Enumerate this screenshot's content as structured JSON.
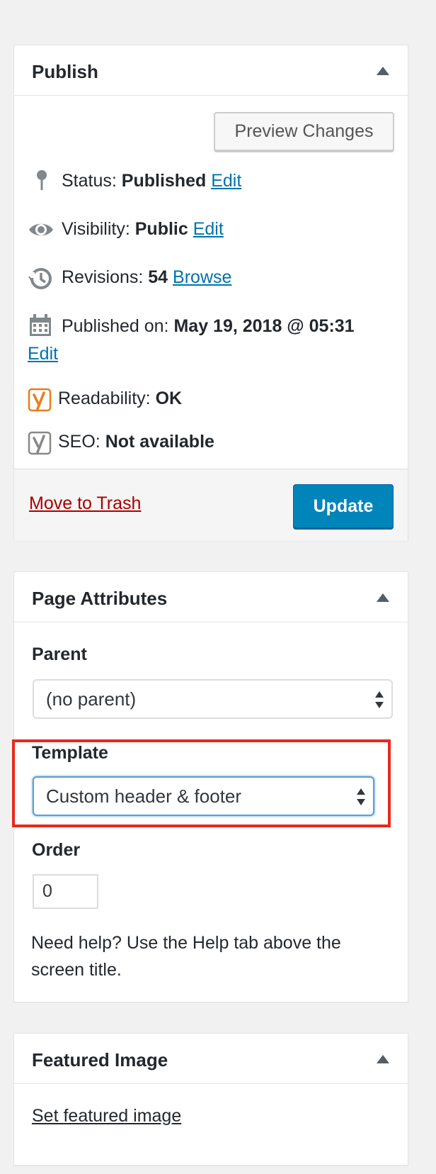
{
  "publish": {
    "title": "Publish",
    "preview_button": "Preview Changes",
    "status": {
      "label": "Status:",
      "value": "Published",
      "link": "Edit"
    },
    "visibility": {
      "label": "Visibility:",
      "value": "Public",
      "link": "Edit"
    },
    "revisions": {
      "label": "Revisions:",
      "value": "54",
      "link": "Browse"
    },
    "published_on": {
      "label": "Published on:",
      "value": "May 19, 2018 @ 05:31",
      "link": "Edit"
    },
    "readability": {
      "label": "Readability:",
      "value": "OK"
    },
    "seo": {
      "label": "SEO:",
      "value": "Not available"
    },
    "trash_link": "Move to Trash",
    "update_button": "Update"
  },
  "page_attributes": {
    "title": "Page Attributes",
    "parent_label": "Parent",
    "parent_value": "(no parent)",
    "template_label": "Template",
    "template_value": "Custom header & footer",
    "order_label": "Order",
    "order_value": "0",
    "help_text": "Need help? Use the Help tab above the screen title."
  },
  "featured_image": {
    "title": "Featured Image",
    "set_link": "Set featured image"
  },
  "colors": {
    "accent": "#0085ba",
    "link": "#0073aa",
    "trash": "#aa0000",
    "highlight": "#e8291c",
    "readability_icon": "#ee7c1b"
  }
}
